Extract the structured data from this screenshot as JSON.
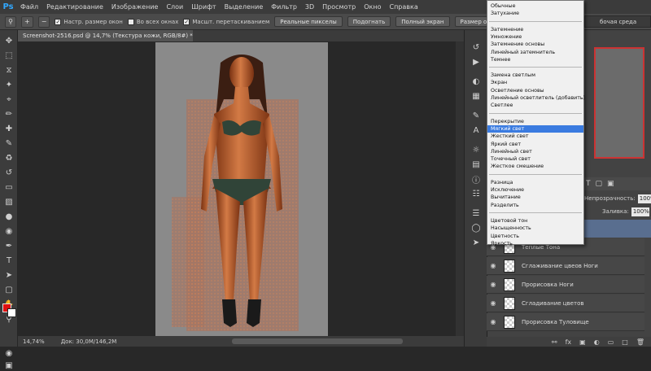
{
  "app": {
    "logo": "Ps"
  },
  "menu": [
    "Файл",
    "Редактирование",
    "Изображение",
    "Слои",
    "Шрифт",
    "Выделение",
    "Фильтр",
    "3D",
    "Просмотр",
    "Окно",
    "Справка"
  ],
  "options": {
    "checkboxes": [
      "Настр. размер окон",
      "Во всех окнах",
      "Масшт. перетаскиванием"
    ],
    "buttons": [
      "Реальные пикселы",
      "Подогнать",
      "Полный экран",
      "Размер оттиска"
    ],
    "workspace": "бочая среда"
  },
  "document": {
    "tab_title": "Screenshot-2516.psd @ 14,7% (Текстура кожи, RGB/8#) *"
  },
  "status": {
    "zoom": "14,74%",
    "doc": "Док: 30,0M/146,2M"
  },
  "layers_panel": {
    "opacity_label": "Непрозрачность:",
    "opacity_value": "100%",
    "fill_label": "Заливка:",
    "fill_value": "100%",
    "layers": [
      "Теплые Тона",
      "Сглаживание цвеов Ноги",
      "Прорисовка Ноги",
      "Сгладивание цветов",
      "Прорисовка Туловище"
    ]
  },
  "blend_modes": {
    "groups": [
      [
        "Обычные",
        "Затухание"
      ],
      [
        "Затемнение",
        "Умножение",
        "Затемнение основы",
        "Линейный затемнитель",
        "Темнее"
      ],
      [
        "Замена светлым",
        "Экран",
        "Осветление основы",
        "Линейный осветлитель (добавить)",
        "Светлее"
      ],
      [
        "Перекрытие",
        "Мягкий свет",
        "Жесткий свет",
        "Яркий свет",
        "Линейный свет",
        "Точечный свет",
        "Жесткое смешение"
      ],
      [
        "Разница",
        "Исключение",
        "Вычитание",
        "Разделить"
      ],
      [
        "Цветовой тон",
        "Насыщенность",
        "Цветность",
        "Яркость"
      ]
    ],
    "selected": "Мягкий свет"
  },
  "colors": {
    "foreground": "#e01010",
    "background": "#ffffff",
    "highlight": "#3a7be0",
    "active_layer": "#596e8f"
  }
}
